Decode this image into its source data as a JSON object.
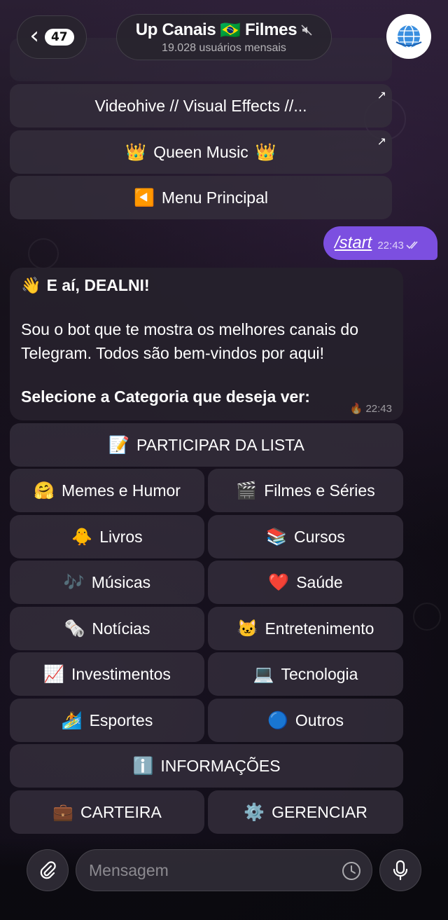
{
  "header": {
    "back_count": "47",
    "chat_title_left": "Up Canais",
    "chat_title_flag": "🇧🇷",
    "chat_title_right": "Filmes",
    "subtitle": "19.028 usuários mensais"
  },
  "top_buttons": [
    {
      "label": "Videohive // Visual Effects //...",
      "emoji": ""
    },
    {
      "label": "Queen Music",
      "emoji": "👑"
    },
    {
      "label": "Menu Principal",
      "emoji": "◀️"
    }
  ],
  "outgoing": {
    "text": "/start",
    "time": "22:43"
  },
  "incoming": {
    "greeting_emoji": "👋",
    "greeting": "E aí, DEALNI!",
    "body": "Sou o bot que te mostra os melhores canais do Telegram. Todos são bem-vindos por aqui!",
    "cta": "Selecione a Categoria que deseja ver:",
    "meta_emoji": "🔥",
    "time": "22:43"
  },
  "keyboard": {
    "participar": {
      "emoji": "📝",
      "label": "PARTICIPAR DA LISTA"
    },
    "rows": [
      [
        {
          "emoji": "🤗",
          "label": "Memes e Humor"
        },
        {
          "emoji": "🎬",
          "label": "Filmes e Séries"
        }
      ],
      [
        {
          "emoji": "🐥",
          "label": "Livros"
        },
        {
          "emoji": "📚",
          "label": "Cursos"
        }
      ],
      [
        {
          "emoji": "🎶",
          "label": "Músicas"
        },
        {
          "emoji": "❤️",
          "label": "Saúde"
        }
      ],
      [
        {
          "emoji": "🗞️",
          "label": "Notícias"
        },
        {
          "emoji": "🐱",
          "label": "Entretenimento"
        }
      ],
      [
        {
          "emoji": "📈",
          "label": "Investimentos"
        },
        {
          "emoji": "💻",
          "label": "Tecnologia"
        }
      ],
      [
        {
          "emoji": "🏄",
          "label": "Esportes"
        },
        {
          "emoji": "🔵",
          "label": "Outros"
        }
      ]
    ],
    "info": {
      "emoji": "ℹ️",
      "label": "INFORMAÇÕES"
    },
    "carteira": {
      "emoji": "💼",
      "label": "CARTEIRA"
    },
    "gerenciar": {
      "emoji": "⚙️",
      "label": "GERENCIAR"
    }
  },
  "input": {
    "placeholder": "Mensagem"
  },
  "colors": {
    "accent": "#7c4fe0",
    "button_bg": "#342e3c",
    "bubble_bg": "#26212c"
  }
}
